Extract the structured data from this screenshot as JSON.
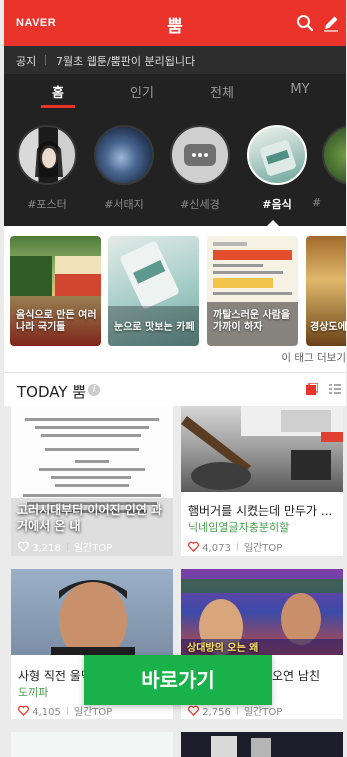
{
  "header": {
    "logo": "NAVER",
    "title": "뿜"
  },
  "notice": {
    "label": "공지",
    "text": "7월초 웹툰/뿜판이 분리됩니다"
  },
  "tabs": [
    {
      "label": "홈",
      "active": true
    },
    {
      "label": "인기",
      "active": false
    },
    {
      "label": "전체",
      "active": false
    },
    {
      "label": "MY",
      "active": false
    }
  ],
  "tags": [
    {
      "label": "#포스터",
      "active": false
    },
    {
      "label": "#서태지",
      "active": false
    },
    {
      "label": "#신세경",
      "active": false
    },
    {
      "label": "#음식",
      "active": true
    },
    {
      "label": "#",
      "active": false
    }
  ],
  "related_cards": [
    {
      "caption": "음식으로 만든 여러 나라 국기들"
    },
    {
      "caption": "눈으로 맛보는 카페"
    },
    {
      "caption": "까탈스러운 사람을 가까이 하자"
    },
    {
      "caption": "경상도에 식"
    }
  ],
  "more_tags": "이 태그 더보기",
  "today": {
    "title": "TODAY 뿜",
    "info": "i"
  },
  "items": [
    {
      "title": "고러시대부터 이어진 인연 과거에서 온 내",
      "source": "",
      "likes": "3,218",
      "badge": "일간TOP",
      "thumb_text": "고러시대부터 이어진 인연\n과거에서 온 내"
    },
    {
      "title": "햄버거를 시켰는데 만두가 ...",
      "source": "닉네임열글자충분히할",
      "likes": "4,073",
      "badge": "일간TOP"
    },
    {
      "title": "사형 직전 울먹",
      "source": "도끼파",
      "likes": "4,105",
      "badge": "일간TOP"
    },
    {
      "title": "오연 남친",
      "source": "",
      "likes": "2,756",
      "badge": "일간TOP",
      "thumb_text": "상대방의 오는 왜"
    }
  ],
  "go_button": "바로가기",
  "colors": {
    "brand_red": "#e9332b",
    "go_green": "#18b14a",
    "source_green": "#4a9c4f"
  }
}
